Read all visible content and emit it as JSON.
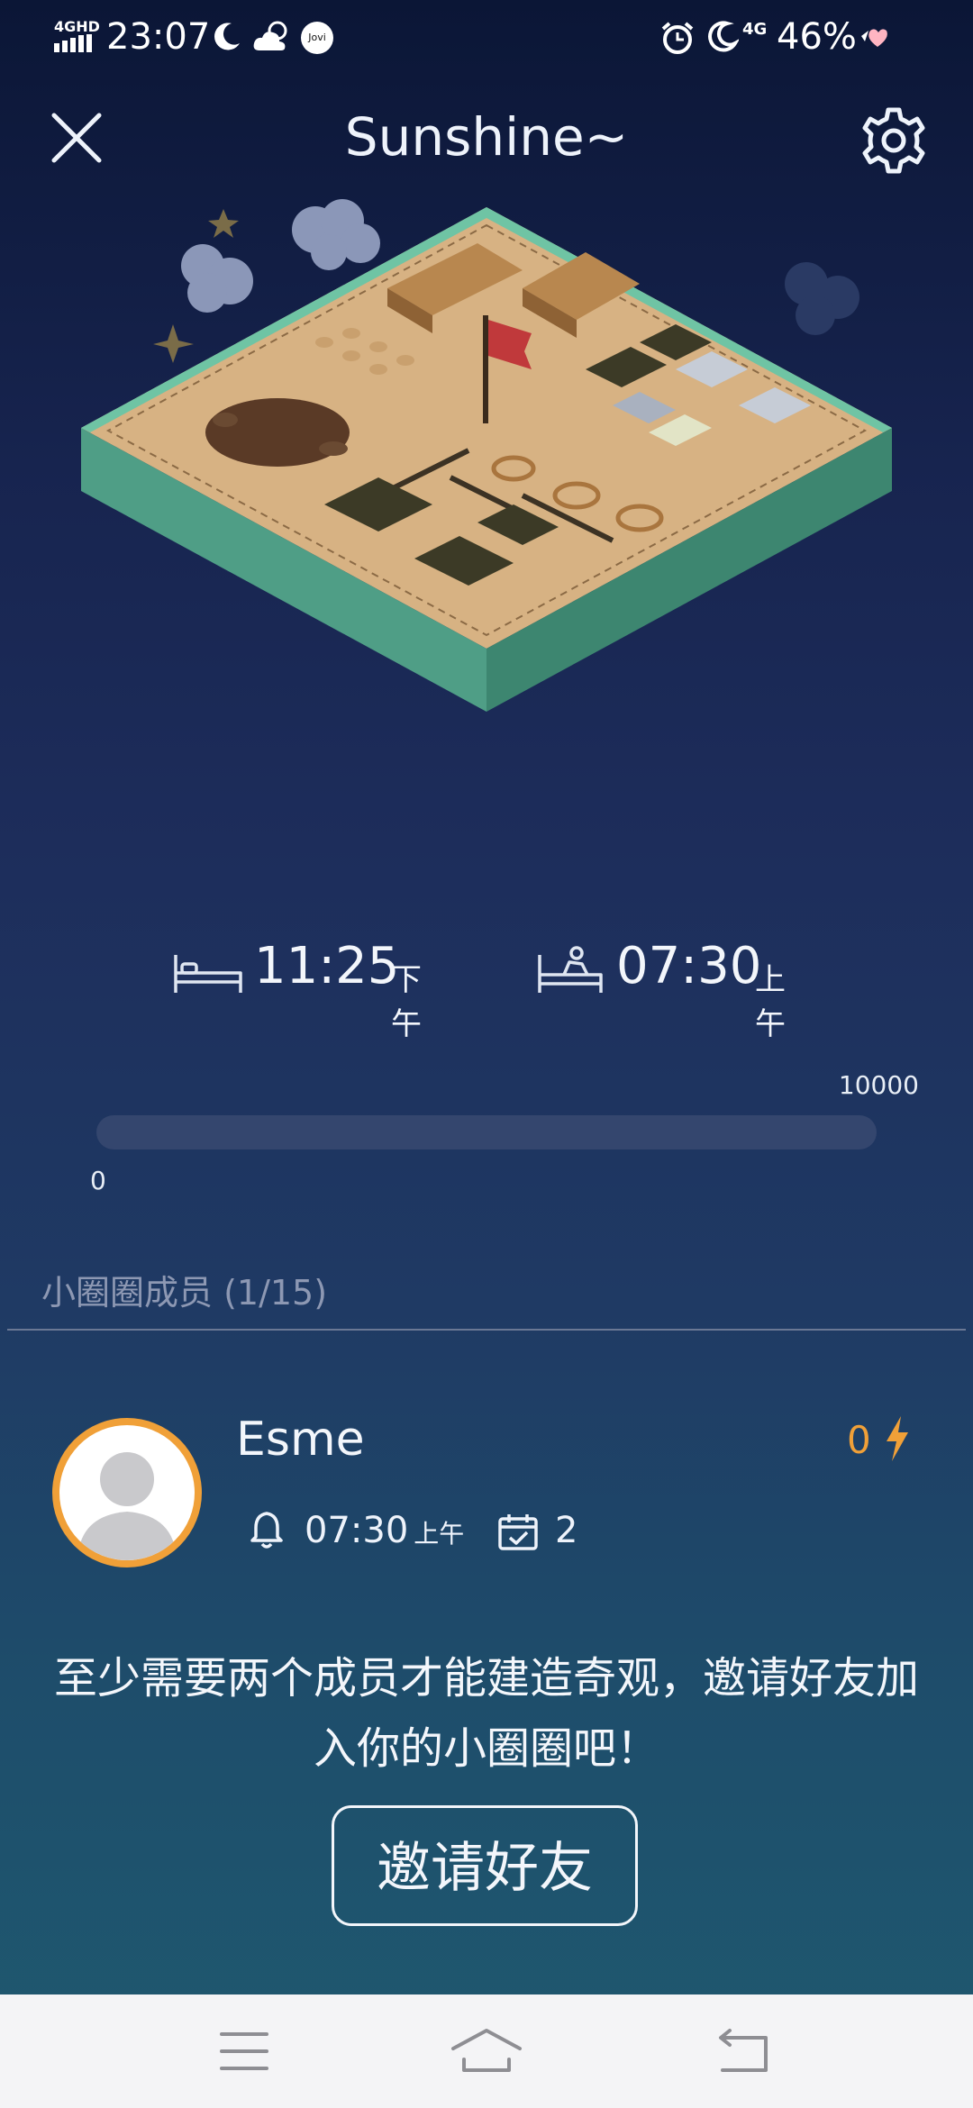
{
  "status_bar": {
    "network": "4GHD",
    "time": "23:07",
    "app_badge": "Jovi",
    "signal_label": "4G",
    "battery": "46%"
  },
  "header": {
    "title": "Sunshine~"
  },
  "schedule": {
    "sleep_time": "11:25",
    "sleep_period": "下午",
    "wake_time": "07:30",
    "wake_period": "上午"
  },
  "progress": {
    "max_label": "10000",
    "min_label": "0",
    "value": 0,
    "max": 10000
  },
  "members": {
    "title": "小圈圈成员 (1/15)",
    "list": [
      {
        "name": "Esme",
        "energy": "0",
        "alarm_time": "07:30",
        "alarm_period": "上午",
        "checkins": "2"
      }
    ]
  },
  "hint": "至少需要两个成员才能建造奇观，邀请好友加入你的小圈圈吧！",
  "invite_button": "邀请好友",
  "colors": {
    "accent": "#f0a038",
    "background_top": "#0b1636",
    "background_bottom": "#1f5a70",
    "progress_track": "#34466e",
    "nav_bar": "#f4f4f6"
  },
  "icons": {
    "close": "close-icon",
    "settings": "gear-icon",
    "sleep": "bed-icon",
    "wake": "bed-wake-icon",
    "energy": "lightning-icon",
    "alarm": "bell-icon",
    "checkin": "calendar-check-icon",
    "nav_menu": "menu-icon",
    "nav_home": "home-icon",
    "nav_back": "back-icon"
  }
}
